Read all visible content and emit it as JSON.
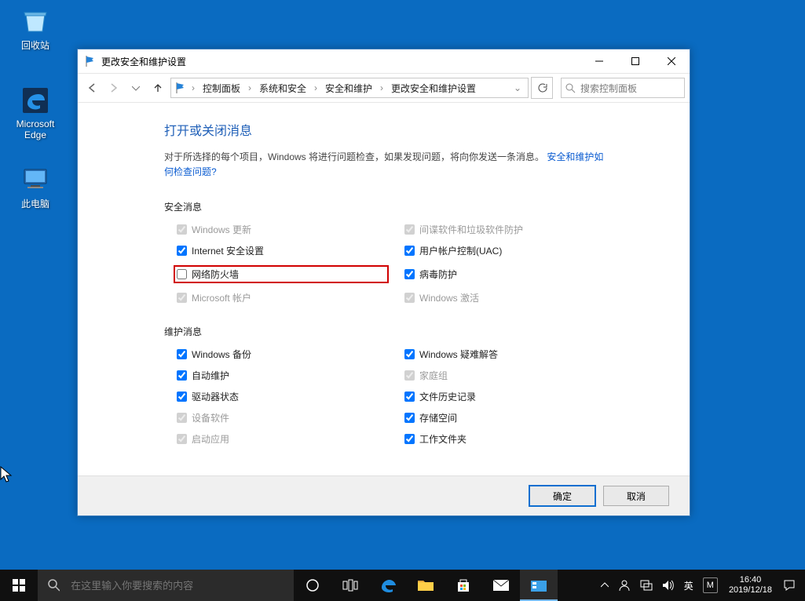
{
  "desktop": {
    "recycle": "回收站",
    "edge_l1": "Microsoft",
    "edge_l2": "Edge",
    "thispc": "此电脑"
  },
  "window": {
    "title": "更改安全和维护设置",
    "breadcrumb": {
      "p1": "控制面板",
      "p2": "系统和安全",
      "p3": "安全和维护",
      "p4": "更改安全和维护设置"
    },
    "search_placeholder": "搜索控制面板",
    "heading": "打开或关闭消息",
    "desc_prefix": "对于所选择的每个项目，Windows 将进行问题检查，如果发现问题，将向你发送一条消息。",
    "desc_link": "安全和维护如何检查问题?",
    "sec_security": "安全消息",
    "sec_maintenance": "维护消息",
    "security": {
      "windows_update": "Windows 更新",
      "spyware": "间谍软件和垃圾软件防护",
      "internet_sec": "Internet 安全设置",
      "uac": "用户帐户控制(UAC)",
      "firewall": "网络防火墙",
      "virus": "病毒防护",
      "ms_account": "Microsoft 帐户",
      "win_activate": "Windows 激活"
    },
    "maintenance": {
      "backup": "Windows 备份",
      "troubleshoot": "Windows 疑难解答",
      "auto_maint": "自动维护",
      "homegroup": "家庭组",
      "drive_status": "驱动器状态",
      "file_history": "文件历史记录",
      "device_soft": "设备软件",
      "storage": "存储空间",
      "startup_apps": "启动应用",
      "workfolders": "工作文件夹"
    },
    "ok": "确定",
    "cancel": "取消"
  },
  "taskbar": {
    "search_placeholder": "在这里输入你要搜索的内容",
    "ime1": "英",
    "ime2": "M",
    "time": "16:40",
    "date": "2019/12/18"
  }
}
